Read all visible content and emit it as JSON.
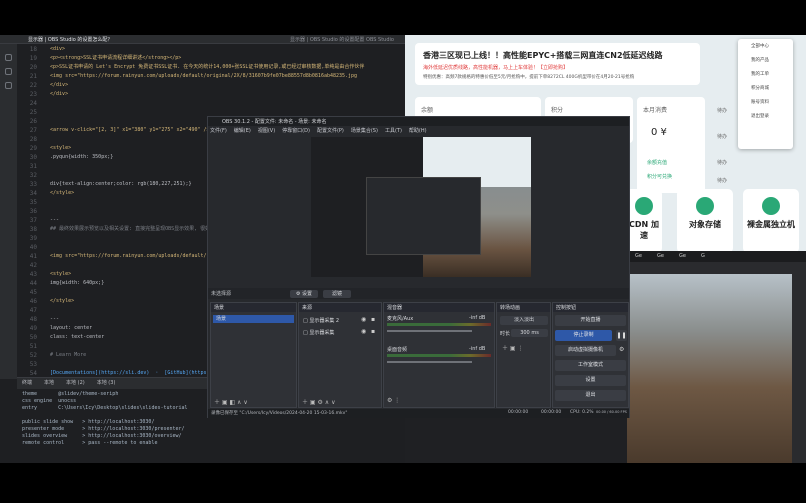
{
  "editor": {
    "tab_title": "显示器 | OBS Studio 的设置怎么配？",
    "tab_right": "显示器 | OBS Studio 的设置配置 OBS Studio",
    "line_numbers": [
      "18",
      "19",
      "20",
      "21",
      "22",
      "23",
      "24",
      "25",
      "26",
      "27",
      "28",
      "29",
      "30",
      "31",
      "32",
      "33",
      "34",
      "35",
      "36",
      "37",
      "38",
      "39",
      "40",
      "41",
      "42",
      "43",
      "44",
      "45",
      "46",
      "47",
      "48",
      "49",
      "50",
      "51",
      "52",
      "53",
      "54",
      "55"
    ],
    "code_lines": [
      "  <div>",
      "  <p><strong>SSL证书申请流程详细讲述</strong></p>",
      "  <p>SSL证书申请的 Let's Encrypt 免费证书SSL证书. 在今天的统计14,000+张SSL证书使用记录,或已经过审核数据,单纯是由合作伙伴",
      "  <img src=\"https://forum.rainyun.com/uploads/default/original/2X/8/31607b9fe07be88557d8b0816ab48235.jpg",
      "  </div>",
      "  </div>",
      "",
      "",
      "",
      "  <arrow v-click=\"[2, 3]\" x1=\"380\" y1=\"275\" x2=\"490\" />",
      "",
      "  <style>",
      "  .pyqun{width: 350px;}",
      "",
      "",
      "  div{text-align:center;color: rgb(180,227,251);}",
      "  </style>",
      "",
      "",
      "  ---",
      "  ## 最终效果展示预览以及相关设置: 直接完整呈现OBS显示效果, 很好地实现",
      "",
      "",
      "  <img src=\"https://forum.rainyun.com/uploads/default/",
      "",
      "  <style>",
      "  img{width: 640px;}",
      "",
      "  </style>",
      "",
      "  ---",
      "  layout: center",
      "  class: text-center",
      "",
      "  # Learn More",
      "",
      "  [Documentations](https://sli.dev)  ·  [GitHub](https://",
      ""
    ],
    "terminal_tabs": [
      "终端",
      "本地",
      "本地 (2)",
      "本地 (3)"
    ],
    "terminal_lines": [
      "theme       @slidev/theme-seriph",
      "css engine  unocss",
      "entry       C:\\Users\\Icy\\Desktop\\slides\\slides-tutorial",
      "",
      "public slide show   > http://localhost:3030/",
      "presenter mode      > http://localhost:3030/presenter/",
      "slides overview     > http://localhost:3030/overview/",
      "remote control      > pass --remote to enable"
    ]
  },
  "website": {
    "banner_title": "香港三区现已上线！！高性能EPYC+搭载三网直连CN2低延迟线路",
    "banner_sub": "海外低延迟优质线路，高性能机器，马上上车体验！【立即抢购】",
    "banner_sub2": "特别优惠：高频7款规格的特惠价低至5元/月抢购中，提前下单8272CL 400G机型带价在4月20-21号抢购",
    "balance_label": "余额",
    "points_label": "积分",
    "month_label": "本月消费",
    "month_value": "0 ¥",
    "buy_label": "余额充值",
    "points_link": "积分可兑换",
    "services": [
      "CDN 加速",
      "对象存储",
      "裸金属独立机"
    ],
    "side_labels": [
      "待办",
      "待办",
      "待办",
      "待办"
    ],
    "menu_items": [
      "全部中心",
      "我的产品",
      "我的工单",
      "积分商城",
      "账号资料",
      "退出登录"
    ]
  },
  "browser": {
    "tab_labels": [
      "Ge",
      "Ge",
      "Ge",
      "G"
    ]
  },
  "obs": {
    "title": "OBS 30.1.2 - 配置文件: 未命名 - 场景: 未命名",
    "menus": [
      "文件(F)",
      "编辑(E)",
      "视图(V)",
      "停靠窗口(D)",
      "配置文件(P)",
      "场景集合(S)",
      "工具(T)",
      "帮助(H)"
    ],
    "scene_label": "未选择源",
    "toolbar_buttons": [
      "⚙ 设置",
      "滤镜"
    ],
    "scenes_title": "场景",
    "scenes": [
      "场景"
    ],
    "sources_title": "来源",
    "sources": [
      "显示器采集 2",
      "显示器采集"
    ],
    "mixer_title": "混音器",
    "mixer_tracks": [
      {
        "name": "麦克风/Aux",
        "level": "-inf dB"
      },
      {
        "name": "桌面音频",
        "level": "-inf dB"
      }
    ],
    "transitions_title": "转场动画",
    "transition_type": "淡入淡出",
    "duration_label": "时长",
    "duration_value": "300 ms",
    "controls_title": "控制按钮",
    "controls": [
      "开始直播",
      "停止录制",
      "启动虚拟摄像机",
      "工作室模式",
      "设置",
      "退出"
    ],
    "status_path": "录像已保存至 \"C:/Users/Icy/Videos/2024-04-20 15-03-16.mkv\"",
    "status_time1": "00:00:00",
    "status_time2": "00:00:00",
    "status_cpu": "CPU: 0.2%",
    "status_fps": "00.00 / 60.00 FPS"
  }
}
